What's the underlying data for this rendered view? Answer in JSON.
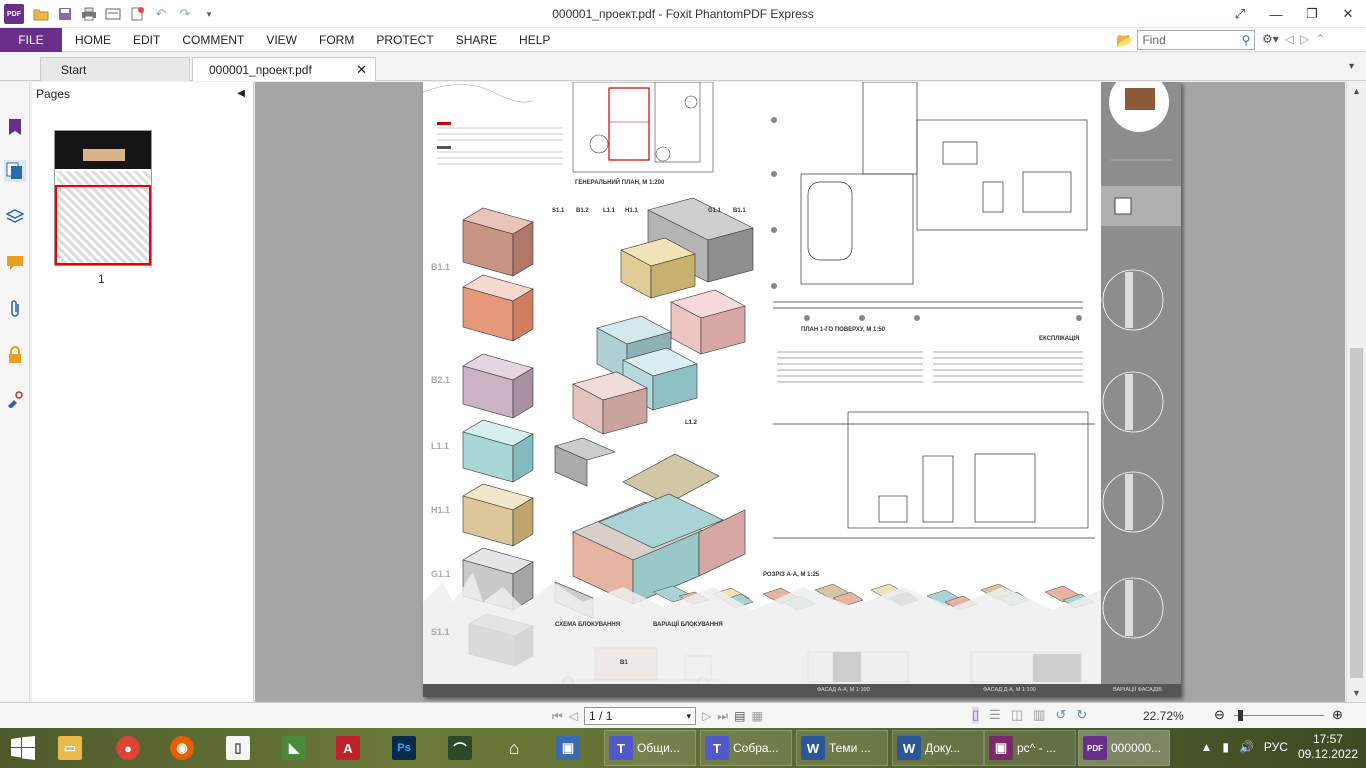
{
  "window": {
    "title": "000001_проект.pdf - Foxit PhantomPDF Express",
    "logo_text": "PDF"
  },
  "menu": {
    "file": "FILE",
    "items": [
      "HOME",
      "EDIT",
      "COMMENT",
      "VIEW",
      "FORM",
      "PROTECT",
      "SHARE",
      "HELP"
    ],
    "find_placeholder": "Find"
  },
  "tabs": {
    "start": "Start",
    "doc": "000001_проект.pdf"
  },
  "pages_panel": {
    "title": "Pages",
    "thumb_label": "1"
  },
  "drawing": {
    "general_plan": "ГЕНЕРАЛЬНИЙ ПЛАН, М 1:200",
    "floor_plan": "ПЛАН 1-ГО ПОВЕРХУ, М 1:50",
    "section": "РОЗРІЗ А-А, М 1:25",
    "block_scheme": "СХЕМА БЛОКУВАННЯ",
    "block_variants": "ВАРІАЦІЇ БЛОКУВАННЯ",
    "facade_aa": "ФАСАД А-А, М 1:100",
    "facade_dd": "ФАСАД Д-А, М 1:100",
    "facade_variants": "ВАРІАЦІЇ ФАСАДІВ",
    "explication": "ЕКСПЛІКАЦІЯ",
    "module_labels": [
      "B1.1",
      "B2.1",
      "L1.1",
      "H1.1",
      "G1.1",
      "S1.1"
    ],
    "col_labels": [
      "S1.1",
      "B1.2",
      "L1.1",
      "H1.1",
      "G1.1",
      "B1.1"
    ],
    "l12_label": "L1.2",
    "b1_label": "B1"
  },
  "status": {
    "page_value": "1 / 1",
    "zoom": "22.72%"
  },
  "taskbar": {
    "apps": [
      {
        "label": "Общи...",
        "icon_letter": "T",
        "color": "#5059c9"
      },
      {
        "label": "Собра...",
        "icon_letter": "T",
        "color": "#5059c9"
      },
      {
        "label": "Теми ...",
        "icon_letter": "W",
        "color": "#2b579a"
      },
      {
        "label": "Доку...",
        "icon_letter": "W",
        "color": "#2b579a"
      },
      {
        "label": "рс^ - ...",
        "icon_letter": "▣",
        "color": "#7a2a6a"
      },
      {
        "label": "000000...",
        "icon_letter": "PDF",
        "color": "#6a2f8a"
      }
    ],
    "lang": "РУС",
    "time": "17:57",
    "date": "09.12.2022"
  },
  "colors": {
    "accent": "#6a2f8a",
    "selection_red": "#e00000",
    "doc_bg": "#a5a5a5"
  },
  "icons": [
    "pdf-logo-icon",
    "open-folder-icon",
    "save-icon",
    "print-icon",
    "undo-icon",
    "redo-icon",
    "search-icon",
    "gear-icon",
    "close-icon"
  ]
}
